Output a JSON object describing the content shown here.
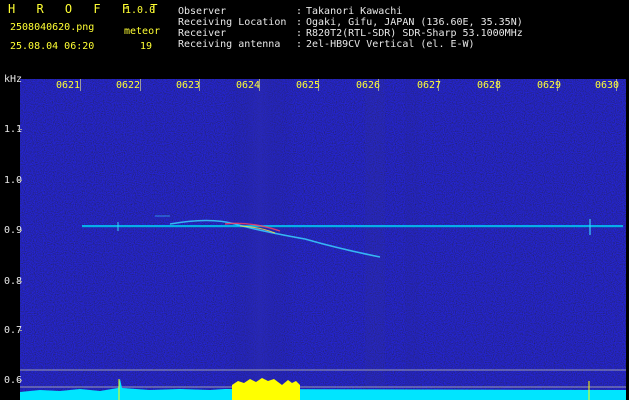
{
  "app": {
    "name": "H R O F F T",
    "version": "1.0.0"
  },
  "file": {
    "name": "2508040620.png",
    "datetime": "25.08.04 06:20"
  },
  "counter": {
    "label": "meteor",
    "value": "19"
  },
  "info": [
    {
      "label": "Observer",
      "value": "Takanori Kawachi"
    },
    {
      "label": "Receiving Location",
      "value": "Ogaki, Gifu, JAPAN (136.60E, 35.35N)"
    },
    {
      "label": "Receiver",
      "value": "R820T2(RTL-SDR) SDR-Sharp 53.1000MHz"
    },
    {
      "label": "Receiving antenna",
      "value": "2el-HB9CV Vertical (el. E-W)"
    }
  ],
  "axis": {
    "unit": "kHz",
    "y_ticks": [
      "1.1",
      "1.0",
      "0.9",
      "0.8",
      "0.7",
      "0.6"
    ],
    "time_ticks": [
      "0621",
      "0622",
      "0623",
      "0624",
      "0625",
      "0626",
      "0627",
      "0628",
      "0629",
      "0630"
    ]
  },
  "colors": {
    "background": "#000000",
    "header_yellow": "#ffff33",
    "header_white": "#e8e8e8",
    "carrier": "#00e5ff",
    "noise": "#1a1a70",
    "level_cyan": "#00e5ff",
    "level_burst": "#ffff00"
  }
}
